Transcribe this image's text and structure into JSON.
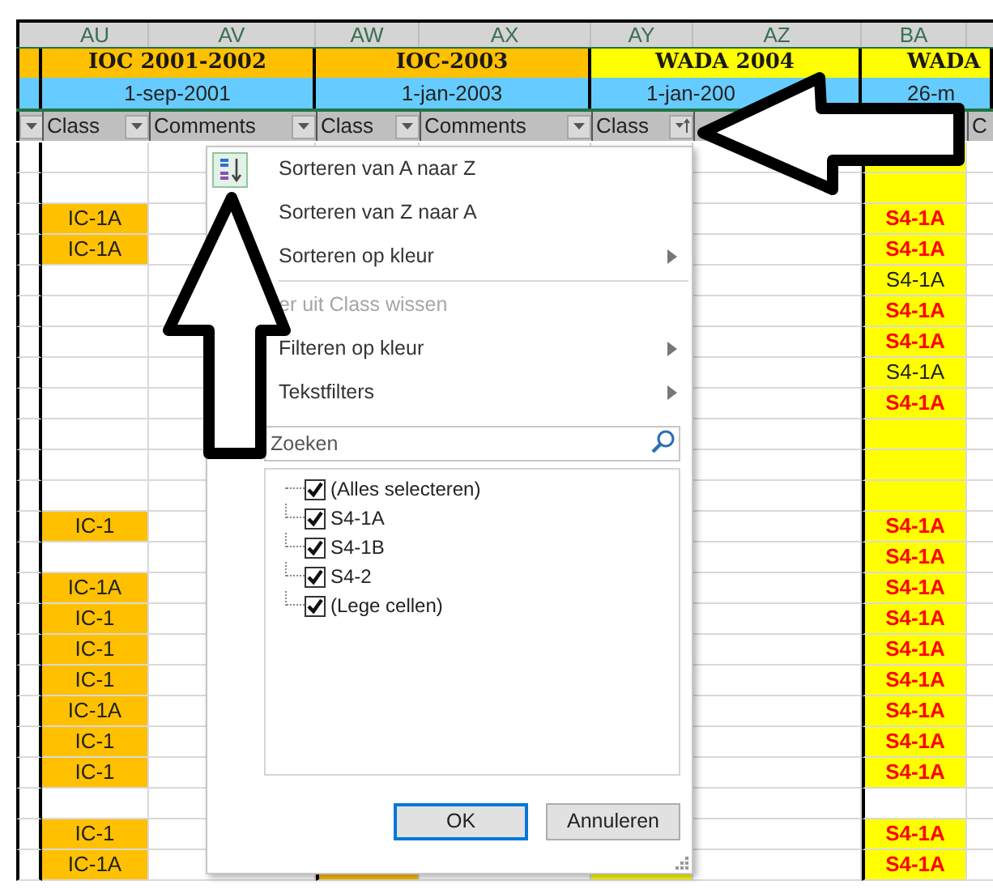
{
  "columns": [
    {
      "letter": "AU",
      "filter_label": "Class",
      "filtered": false
    },
    {
      "letter": "AV",
      "filter_label": "Comments",
      "filtered": false
    },
    {
      "letter": "AW",
      "filter_label": "Class",
      "filtered": false
    },
    {
      "letter": "AX",
      "filter_label": "Comments",
      "filtered": false
    },
    {
      "letter": "AY",
      "filter_label": "Class",
      "filtered": true
    },
    {
      "letter": "AZ"
    },
    {
      "letter": "BA"
    }
  ],
  "partial_column_label": "C",
  "groups": [
    {
      "title": "IOC 2001-2002",
      "date": "1-sep-2001",
      "color": "#ffc000"
    },
    {
      "title": "IOC-2003",
      "date": "1-jan-2003",
      "color": "#ffc000"
    },
    {
      "title": "WADA 2004",
      "date": "1-jan-200",
      "color": "#ffff00"
    },
    {
      "title": "WADA",
      "date": "26-m",
      "color": "#ffff00"
    }
  ],
  "rows": [
    {
      "BA": {
        "highlighted": true
      }
    },
    {
      "BA": {
        "highlighted": true
      }
    },
    {
      "AU": {
        "text": "IC-1A",
        "highlighted": true,
        "flagged": false
      },
      "BA": {
        "text": "S4-1A",
        "highlighted": true,
        "flagged": true
      }
    },
    {
      "AU": {
        "text": "IC-1A",
        "highlighted": true,
        "flagged": false
      },
      "BA": {
        "text": "S4-1A",
        "highlighted": true,
        "flagged": true
      }
    },
    {
      "BA": {
        "text": "S4-1A",
        "highlighted": true,
        "flagged": false
      }
    },
    {
      "BA": {
        "text": "S4-1A",
        "highlighted": true,
        "flagged": true
      }
    },
    {
      "BA": {
        "text": "S4-1A",
        "highlighted": true,
        "flagged": true
      }
    },
    {
      "BA": {
        "text": "S4-1A",
        "highlighted": true,
        "flagged": false
      }
    },
    {
      "BA": {
        "text": "S4-1A",
        "highlighted": true,
        "flagged": true
      }
    },
    {
      "BA": {
        "highlighted": true
      }
    },
    {
      "BA": {
        "highlighted": true
      }
    },
    {
      "BA": {
        "highlighted": true
      }
    },
    {
      "AU": {
        "text": "IC-1",
        "highlighted": true,
        "flagged": false
      },
      "BA": {
        "text": "S4-1A",
        "highlighted": true,
        "flagged": true
      }
    },
    {
      "BA": {
        "text": "S4-1A",
        "highlighted": true,
        "flagged": true
      }
    },
    {
      "AU": {
        "text": "IC-1A",
        "highlighted": true,
        "flagged": false
      },
      "BA": {
        "text": "S4-1A",
        "highlighted": true,
        "flagged": true
      }
    },
    {
      "AU": {
        "text": "IC-1",
        "highlighted": true,
        "flagged": false
      },
      "BA": {
        "text": "S4-1A",
        "highlighted": true,
        "flagged": true
      }
    },
    {
      "AU": {
        "text": "IC-1",
        "highlighted": true,
        "flagged": false
      },
      "BA": {
        "text": "S4-1A",
        "highlighted": true,
        "flagged": true
      }
    },
    {
      "AU": {
        "text": "IC-1",
        "highlighted": true,
        "flagged": false
      },
      "BA": {
        "text": "S4-1A",
        "highlighted": true,
        "flagged": true
      }
    },
    {
      "AU": {
        "text": "IC-1A",
        "highlighted": true,
        "flagged": false
      },
      "BA": {
        "text": "S4-1A",
        "highlighted": true,
        "flagged": true
      }
    },
    {
      "AU": {
        "text": "IC-1",
        "highlighted": true,
        "flagged": false
      },
      "BA": {
        "text": "S4-1A",
        "highlighted": true,
        "flagged": true
      }
    },
    {
      "AU": {
        "text": "IC-1",
        "highlighted": true,
        "flagged": false
      },
      "BA": {
        "text": "S4-1A",
        "highlighted": true,
        "flagged": true
      }
    },
    {},
    {
      "AU": {
        "text": "IC-1",
        "highlighted": true,
        "flagged": false
      },
      "BA": {
        "text": "S4-1A",
        "highlighted": true,
        "flagged": true
      }
    },
    {
      "AU": {
        "text": "IC-1A",
        "highlighted": true,
        "flagged": false
      },
      "AW": {
        "highlighted": true
      },
      "AY": {
        "highlighted": true
      },
      "BA": {
        "text": "S4-1A",
        "highlighted": true,
        "flagged": true
      }
    }
  ],
  "filter_menu": {
    "items": [
      {
        "kind": "sort_asc",
        "label": "Sorteren van A naar Z",
        "disabled": false,
        "submenu": false
      },
      {
        "kind": "sort_desc",
        "label": "Sorteren van Z naar A",
        "disabled": false,
        "submenu": false
      },
      {
        "kind": "command",
        "label": "Sorteren op kleur",
        "disabled": false,
        "submenu": true
      },
      {
        "kind": "separator"
      },
      {
        "kind": "command",
        "label": "er uit Class wissen",
        "disabled": true,
        "submenu": false
      },
      {
        "kind": "command",
        "label": "Filteren op kleur",
        "disabled": false,
        "submenu": true
      },
      {
        "kind": "command",
        "label": "Tekstfilters",
        "disabled": false,
        "submenu": true
      }
    ],
    "search": {
      "placeholder": "Zoeken"
    },
    "values": [
      {
        "label": "(Alles selecteren)",
        "checked": true
      },
      {
        "label": "S4-1A",
        "checked": true
      },
      {
        "label": "S4-1B",
        "checked": true
      },
      {
        "label": "S4-2",
        "checked": true
      },
      {
        "label": "(Lege cellen)",
        "checked": true
      }
    ],
    "buttons": [
      {
        "label": "OK",
        "focused": true
      },
      {
        "label": "Annuleren",
        "focused": false
      }
    ]
  }
}
